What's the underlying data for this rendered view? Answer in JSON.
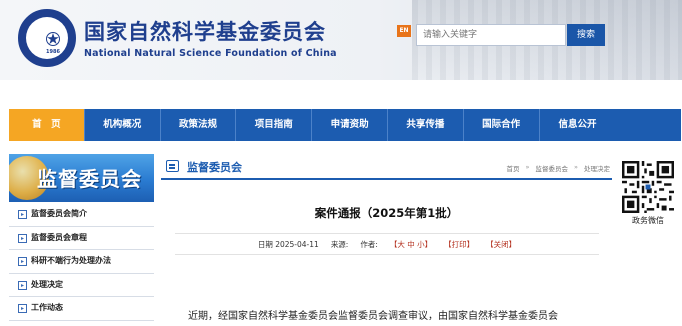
{
  "header": {
    "org_name_cn": "国家自然科学基金委员会",
    "org_name_en": "National Natural Science Foundation of China",
    "logo_year": "1986",
    "english_badge": "EN",
    "search_placeholder": "请输入关键字",
    "search_button": "搜索"
  },
  "nav": {
    "items": [
      {
        "label": "首　页",
        "active": true
      },
      {
        "label": "机构概况"
      },
      {
        "label": "政策法规"
      },
      {
        "label": "项目指南"
      },
      {
        "label": "申请资助"
      },
      {
        "label": "共享传播"
      },
      {
        "label": "国际合作"
      },
      {
        "label": "信息公开"
      }
    ]
  },
  "sidebar": {
    "banner_title": "监督委员会",
    "items": [
      {
        "label": "监督委员会简介"
      },
      {
        "label": "监督委员会章程"
      },
      {
        "label": "科研不端行为处理办法"
      },
      {
        "label": "处理决定"
      },
      {
        "label": "工作动态"
      }
    ]
  },
  "main": {
    "section_title": "监督委员会",
    "breadcrumb": [
      "首页",
      "监督委员会",
      "处理决定"
    ],
    "breadcrumb_sep": "»",
    "article_title": "案件通报（2025年第1批）",
    "date_label": "日期 2025-04-11",
    "source_label": "来源:",
    "author_label": "作者:",
    "font_size_ctrl": "【大 中 小】",
    "print_ctrl": "【打印】",
    "close_ctrl": "【关闭】",
    "body_first_line": "近期，经国家自然科学基金委员会监督委员会调查审议，由国家自然科学基金委员会"
  },
  "qr": {
    "caption": "政务微信"
  },
  "colors": {
    "primary": "#1c5cb0",
    "active_nav": "#f5a623",
    "org_text": "#1f3f8e"
  }
}
